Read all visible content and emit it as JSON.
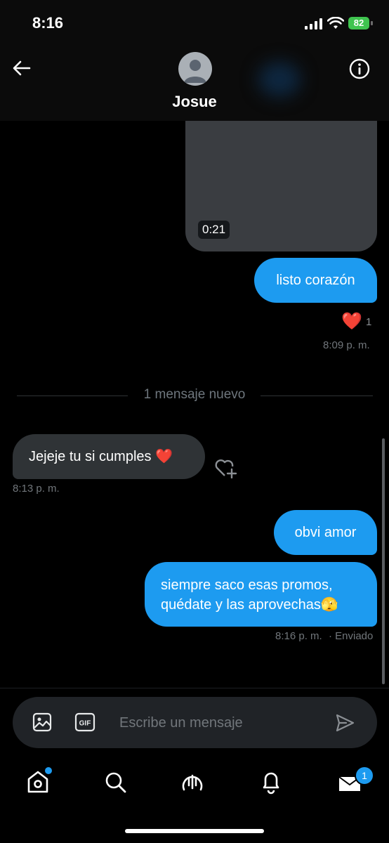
{
  "status_bar": {
    "time": "8:16",
    "battery": "82"
  },
  "header": {
    "contact_name": "Josue"
  },
  "messages": {
    "video_duration": "0:21",
    "msg1": "listo corazón",
    "msg1_reaction_count": "1",
    "msg1_time": "8:09 p. m.",
    "new_messages_divider": "1 mensaje nuevo",
    "incoming": "Jejeje tu si cumples ❤️",
    "incoming_time": "8:13 p. m.",
    "msg2": "obvi amor",
    "msg3_line1": "siempre saco esas promos,",
    "msg3_line2": "quédate y las aprovechas🫣",
    "msg3_time": "8:16 p. m.",
    "msg3_status": "· Enviado"
  },
  "composer": {
    "placeholder": "Escribe un mensaje",
    "gif_label": "GIF"
  },
  "nav": {
    "messages_badge": "1"
  },
  "colors": {
    "accent": "#1d9bf0",
    "incoming_bubble": "#2f3336",
    "background": "#000000"
  }
}
